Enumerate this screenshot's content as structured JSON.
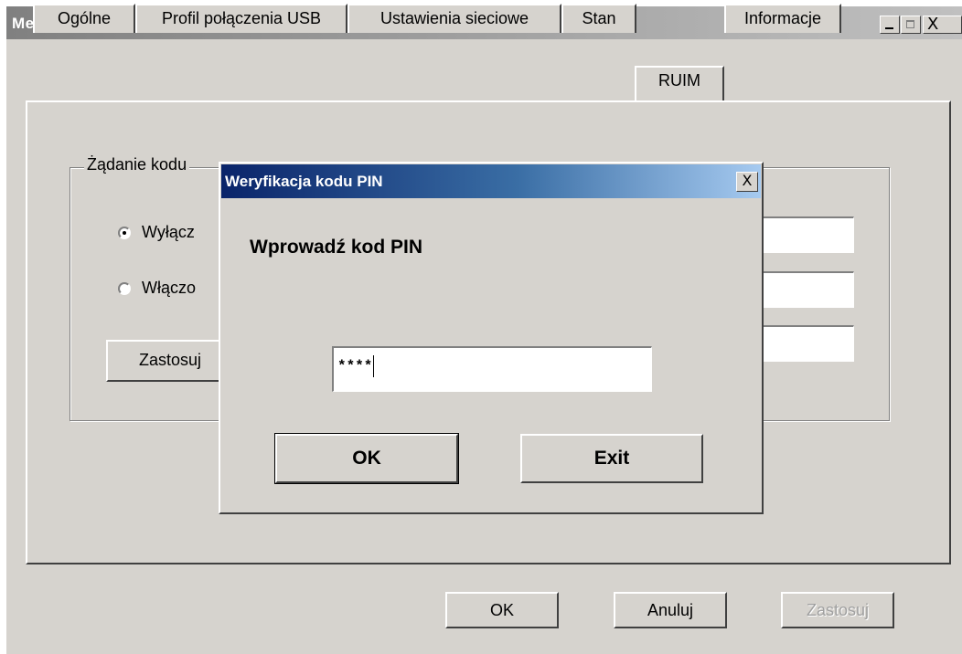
{
  "window": {
    "title": "Menu",
    "controls": {
      "minimize_icon": "minimize-icon",
      "maximize_icon": "maximize-icon",
      "close_glyph": "X"
    }
  },
  "tabs": [
    {
      "label": "Ogólne",
      "active": false
    },
    {
      "label": "Profil połączenia USB",
      "active": false
    },
    {
      "label": "Ustawienia sieciowe",
      "active": false
    },
    {
      "label": "Stan",
      "active": false
    },
    {
      "label": "RUIM",
      "active": true
    },
    {
      "label": "Informacje",
      "active": false
    }
  ],
  "ruim_panel": {
    "group_label": "Żądanie kodu",
    "radio_disabled_label": "Wyłącz",
    "radio_enabled_label": "Włączo",
    "selected_radio": "disabled",
    "apply_button_label": "Zastosuj"
  },
  "bottom_buttons": {
    "ok_label": "OK",
    "cancel_label": "Anuluj",
    "apply_label": "Zastosuj",
    "apply_enabled": false
  },
  "pin_dialog": {
    "title": "Weryfikacja kodu PIN",
    "close_glyph": "X",
    "prompt": "Wprowadź kod PIN",
    "pin_value": "****",
    "ok_label": "OK",
    "exit_label": "Exit"
  },
  "colors": {
    "face": "#d6d3ce",
    "dialog_title_start": "#0a246a",
    "dialog_title_end": "#a6caf0",
    "window_title_inactive": "#808080"
  }
}
